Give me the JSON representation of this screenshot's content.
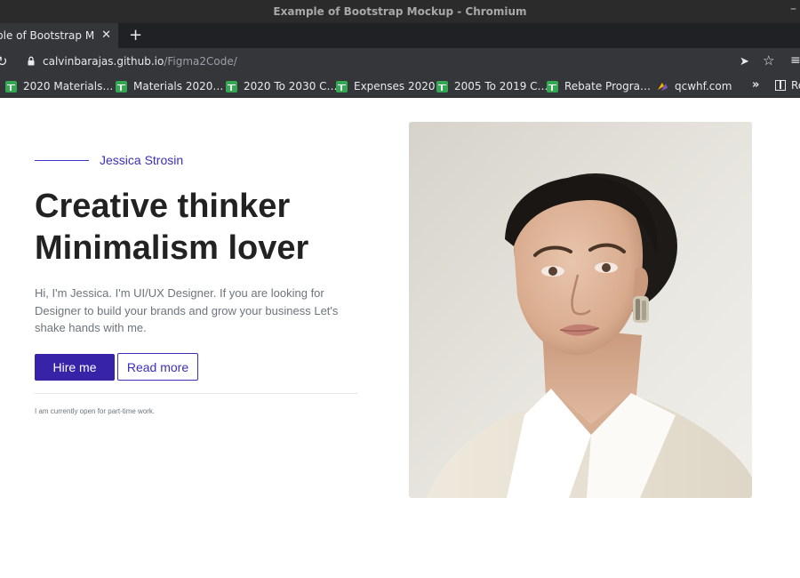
{
  "window": {
    "title": "Example of Bootstrap Mockup - Chromium",
    "minimize_glyph": "–"
  },
  "tabs": {
    "active_title": "ple of Bootstrap Mo",
    "close_glyph": "✕",
    "new_tab_glyph": "+"
  },
  "address_bar": {
    "host": "calvinbarajas.github.io",
    "path": "/Figma2Code/"
  },
  "bookmarks": {
    "items": [
      {
        "label": "2020 Materials…",
        "icon": "google-sheets-icon"
      },
      {
        "label": "Materials 2020…",
        "icon": "google-sheets-icon"
      },
      {
        "label": "2020 To 2030 C…",
        "icon": "google-sheets-icon"
      },
      {
        "label": "Expenses 2020",
        "icon": "google-sheets-icon"
      },
      {
        "label": "2005 To 2019 C…",
        "icon": "google-sheets-icon"
      },
      {
        "label": "Rebate Progra…",
        "icon": "google-sheets-icon"
      },
      {
        "label": "qcwhf.com",
        "icon": "qcwhf-favicon"
      }
    ],
    "overflow_glyph": "»",
    "reading_list_label": "Re"
  },
  "hero": {
    "name": "Jessica Strosin",
    "headline_line1": "Creative thinker",
    "headline_line2": "Minimalism lover",
    "intro": "Hi, I'm Jessica. I'm UI/UX Designer. If you are looking for Designer to build your brands and grow your business Let's shake hands with me.",
    "hire_label": "Hire me",
    "read_more_label": "Read more",
    "note": "I am currently open for part-time work."
  },
  "colors": {
    "accent": "#3623a8",
    "accent_text": "#3b2fb8",
    "headline": "#222222",
    "body_text": "#6c757d",
    "chrome_dark": "#202124",
    "chrome_toolbar": "#35363a",
    "sheets_green": "#34a853"
  }
}
